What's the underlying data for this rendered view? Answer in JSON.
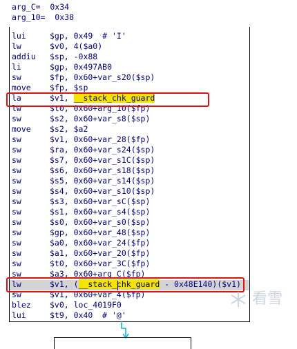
{
  "header": {
    "rows": [
      "arg_C=  0x34",
      "arg_10=  0x38"
    ]
  },
  "code": [
    {
      "m": "lui",
      "ops": "$gp, 0x49  # 'I'"
    },
    {
      "m": "lw",
      "ops": "$v0, 4($a0)"
    },
    {
      "m": "addiu",
      "ops": "$sp, -0x88"
    },
    {
      "m": "li",
      "ops": "$gp, 0x497AB0"
    },
    {
      "m": "sw",
      "ops": "$fp, 0x60+var_s20($sp)"
    },
    {
      "m": "move",
      "ops": "$fp, $sp"
    },
    {
      "m": "la",
      "ops_pre": "$v1, ",
      "ops_hl": "__stack_chk_guard",
      "ops_post": ""
    },
    {
      "m": "lw",
      "ops": "$t0, 0x60+arg_10($fp)"
    },
    {
      "m": "sw",
      "ops": "$s2, 0x60+var_s8($sp)"
    },
    {
      "m": "move",
      "ops": "$s2, $a2"
    },
    {
      "m": "sw",
      "ops": "$v1, 0x60+var_28($fp)"
    },
    {
      "m": "sw",
      "ops": "$ra, 0x60+var_s24($sp)"
    },
    {
      "m": "sw",
      "ops": "$s7, 0x60+var_s1C($sp)"
    },
    {
      "m": "sw",
      "ops": "$s6, 0x60+var_s18($sp)"
    },
    {
      "m": "sw",
      "ops": "$s5, 0x60+var_s14($sp)"
    },
    {
      "m": "sw",
      "ops": "$s4, 0x60+var_s10($sp)"
    },
    {
      "m": "sw",
      "ops": "$s3, 0x60+var_sC($sp)"
    },
    {
      "m": "sw",
      "ops": "$s1, 0x60+var_s4($sp)"
    },
    {
      "m": "sw",
      "ops": "$s0, 0x60+var_s0($sp)"
    },
    {
      "m": "sw",
      "ops": "$gp, 0x60+var_48($sp)"
    },
    {
      "m": "sw",
      "ops": "$a0, 0x60+var_24($fp)"
    },
    {
      "m": "sw",
      "ops": "$a1, 0x60+var_20($fp)"
    },
    {
      "m": "sw",
      "ops": "$t0, 0x60+var_3C($fp)"
    },
    {
      "m": "sw",
      "ops": "$a3, 0x60+arg_C($fp)"
    },
    {
      "m": "lw",
      "ops_pre": "$v1, (",
      "ops_hl": "__stack_chk_guard",
      "ops_post": " - 0x48E140)($v1)"
    },
    {
      "m": "sw",
      "ops": "$v1, 0x60+var_4($fp)"
    },
    {
      "m": "blez",
      "ops": "$v0, loc_4019F0"
    },
    {
      "m": "lui",
      "ops": "$t9, 0x40  # '@'"
    }
  ],
  "watermark": {
    "text": "看雪"
  },
  "colors": {
    "text": "#000080",
    "highlight": "#f5e400",
    "annotation": "#e01010",
    "arrow": "#00b4d8"
  }
}
